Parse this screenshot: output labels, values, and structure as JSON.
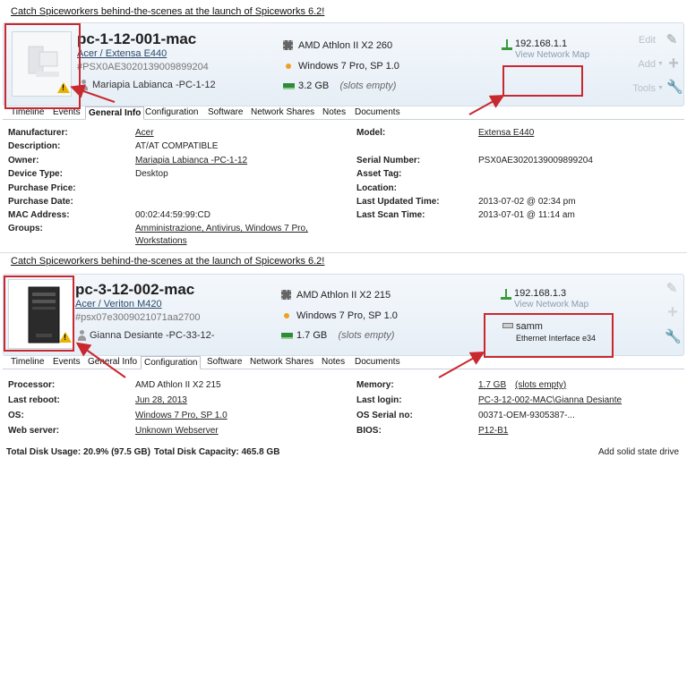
{
  "panel1": {
    "banner": "Catch Spiceworkers behind-the-scenes at the launch of Spiceworks 6.2!",
    "device": {
      "name": "pc-1-12-001-mac",
      "model": "Acer / Extensa E440",
      "serial": "#PSX0AE3020139009899204",
      "owner": "Mariapia Labianca -PC-1-12"
    },
    "specs": {
      "cpu": "AMD Athlon II X2 260",
      "os": "Windows 7 Pro, SP 1.0",
      "ram": "3.2 GB",
      "ram_note": "(slots empty)"
    },
    "network": {
      "ip": "192.168.1.1",
      "map": "View Network Map"
    },
    "actions": {
      "edit": "Edit",
      "add": "Add",
      "tools": "Tools"
    },
    "tabs": [
      "Timeline",
      "Events",
      "General Info",
      "Configuration",
      "Software",
      "Network Shares",
      "Notes",
      "Documents"
    ],
    "active_tab": "General Info",
    "info_left": [
      {
        "label": "Manufacturer:",
        "value": "Acer"
      },
      {
        "label": "Description:",
        "value": "AT/AT COMPATIBLE"
      },
      {
        "label": "Owner:",
        "value": "Mariapia Labianca -PC-1-12"
      },
      {
        "label": "Device Type:",
        "value": "Desktop"
      },
      {
        "label": "Purchase Price:",
        "value": ""
      },
      {
        "label": "Purchase Date:",
        "value": ""
      },
      {
        "label": "MAC Address:",
        "value": "00:02:44:59:99:CD"
      },
      {
        "label": "Groups:",
        "value": "Amministrazione, Antivirus, Windows 7 Pro,",
        "value2": "Workstations"
      }
    ],
    "info_right": [
      {
        "label": "Model:",
        "value": "Extensa E440"
      },
      {
        "label": "Serial Number:",
        "value": "PSX0AE3020139009899204"
      },
      {
        "label": "Asset Tag:",
        "value": ""
      },
      {
        "label": "Location:",
        "value": ""
      },
      {
        "label": "Last Updated Time:",
        "value": "2013-07-02 @ 02:34 pm"
      },
      {
        "label": "Last Scan Time:",
        "value": "2013-07-01 @ 11:14 am"
      }
    ]
  },
  "panel2": {
    "banner": "Catch Spiceworkers behind-the-scenes at the launch of Spiceworks 6.2!",
    "device": {
      "name": "pc-3-12-002-mac",
      "model": "Acer / Veriton M420",
      "serial": "#psx07e3009021071aa2700",
      "owner": "Gianna Desiante -PC-33-12-"
    },
    "specs": {
      "cpu": "AMD Athlon II X2 215",
      "os": "Windows 7 Pro, SP 1.0",
      "ram": "1.7 GB",
      "ram_note": "(slots empty)"
    },
    "network": {
      "ip": "192.168.1.3",
      "map": "View Network Map",
      "iface_name": "samm",
      "iface_desc": "Ethernet Interface e34"
    },
    "tabs": [
      "Timeline",
      "Events",
      "General Info",
      "Configuration",
      "Software",
      "Network Shares",
      "Notes",
      "Documents"
    ],
    "active_tab": "Configuration",
    "config_left": [
      {
        "label": "Processor:",
        "value": "AMD Athlon II X2 215"
      },
      {
        "label": "Last reboot:",
        "value": "Jun 28, 2013"
      },
      {
        "label": "OS:",
        "value": "Windows 7 Pro, SP 1.0"
      },
      {
        "label": "Web server:",
        "value": "Unknown Webserver"
      }
    ],
    "config_right": [
      {
        "label": "Memory:",
        "value": "1.7 GB",
        "note": "(slots empty)"
      },
      {
        "label": "Last login:",
        "value": "PC-3-12-002-MAC\\Gianna Desiante"
      },
      {
        "label": "OS Serial no:",
        "value": "00371-OEM-9305387-..."
      },
      {
        "label": "BIOS:",
        "value": "P12-B1"
      }
    ],
    "footer_left": "Total Disk Usage: 20.9% (97.5 GB)",
    "footer_mid": "Total Disk Capacity: 465.8 GB",
    "footer_right": "Add solid state drive"
  },
  "colors": {
    "annotation_red": "#c8282e",
    "tab_border": "#b8c0c8",
    "header_bg": "#e6eef6"
  }
}
